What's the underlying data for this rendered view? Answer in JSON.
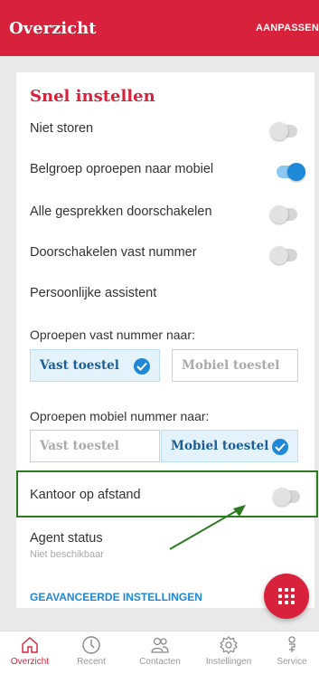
{
  "header": {
    "title": "Overzicht",
    "action": "AANPASSEN"
  },
  "quick": {
    "title": "Snel instellen",
    "toggles": [
      {
        "label": "Niet storen",
        "on": false
      },
      {
        "label": "Belgroep oproepen naar mobiel",
        "on": true
      },
      {
        "label": "Alle gesprekken doorschakelen",
        "on": false
      },
      {
        "label": "Doorschakelen vast nummer",
        "on": false
      }
    ],
    "assistant": "Persoonlijke assistent",
    "fixed": {
      "label": "Oproepen vast nummer naar:",
      "options": [
        "Vast toestel",
        "Mobiel toestel"
      ],
      "selected": 0
    },
    "mobile": {
      "label": "Oproepen mobiel nummer naar:",
      "options": [
        "Vast toestel",
        "Mobiel toestel"
      ],
      "selected": 1
    },
    "remote": {
      "label": "Kantoor op afstand",
      "on": false
    },
    "agent": {
      "label": "Agent status",
      "status": "Niet beschikbaar"
    },
    "advanced": "GEAVANCEERDE INSTELLINGEN"
  },
  "colors": {
    "brand": "#d8213a",
    "accent": "#1e88d9",
    "highlight": "#2b7a1f"
  },
  "nav": [
    {
      "label": "Overzicht",
      "icon": "home-icon",
      "active": true
    },
    {
      "label": "Recent",
      "icon": "clock-icon",
      "active": false
    },
    {
      "label": "Contacten",
      "icon": "contacts-icon",
      "active": false
    },
    {
      "label": "Instellingen",
      "icon": "gear-icon",
      "active": false
    },
    {
      "label": "Service",
      "icon": "service-icon",
      "active": false
    }
  ]
}
